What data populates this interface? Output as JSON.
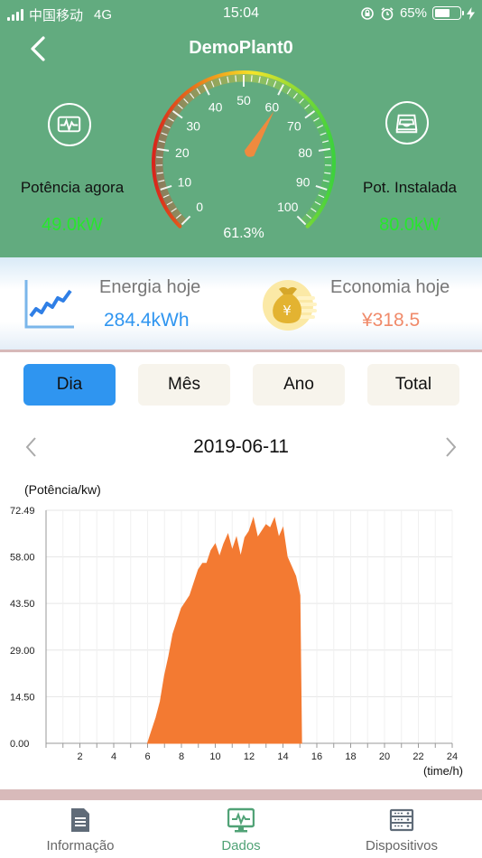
{
  "status_bar": {
    "carrier": "中国移动",
    "network": "4G",
    "time": "15:04",
    "battery_percent": "65%",
    "battery_level": 0.65
  },
  "header": {
    "title": "DemoPlant0",
    "back_icon": "chevron-left-icon"
  },
  "left_panel": {
    "icon": "pulse-icon",
    "label": "Potência agora",
    "value": "49.0kW"
  },
  "right_panel": {
    "icon": "inbox-tray-icon",
    "label": "Pot. Instalada",
    "value": "80.0kW"
  },
  "gauge": {
    "ticks": [
      "0",
      "10",
      "20",
      "30",
      "40",
      "50",
      "60",
      "70",
      "80",
      "90",
      "100"
    ],
    "percent": 61.3,
    "percent_label": "61.3%",
    "needle_color": "#ef8a3e"
  },
  "summary": {
    "energy": {
      "icon": "line-chart-icon",
      "label": "Energia hoje",
      "value": "284.4kWh",
      "color": "#2f95f0"
    },
    "savings": {
      "icon": "money-bag-icon",
      "label": "Economia hoje",
      "value": "¥318.5",
      "color": "#f08a6a"
    }
  },
  "tabs": [
    {
      "label": "Dia",
      "active": true
    },
    {
      "label": "Mês",
      "active": false
    },
    {
      "label": "Ano",
      "active": false
    },
    {
      "label": "Total",
      "active": false
    }
  ],
  "date_nav": {
    "date": "2019-06-11"
  },
  "chart_data": {
    "type": "area",
    "ylabel": "(Potência/kw)",
    "xlabel": "(time/h)",
    "yticks": [
      "72.49",
      "58.00",
      "43.50",
      "29.00",
      "14.50",
      "0.00"
    ],
    "ylim": [
      0,
      72.49
    ],
    "xlim": [
      0,
      24
    ],
    "xticks": [
      "2",
      "4",
      "6",
      "8",
      "10",
      "12",
      "14",
      "16",
      "18",
      "20",
      "22",
      "24"
    ],
    "grid": true,
    "color": "#f37a32",
    "series": [
      {
        "x": [
          6.0,
          6.25,
          6.5,
          6.75,
          7.0,
          7.25,
          7.5,
          7.75,
          8.0,
          8.25,
          8.5,
          8.75,
          9.0,
          9.25,
          9.5,
          9.75,
          10.0,
          10.25,
          10.5,
          10.75,
          11.0,
          11.25,
          11.5,
          11.75,
          12.0,
          12.25,
          12.5,
          12.75,
          13.0,
          13.25,
          13.5,
          13.75,
          14.0,
          14.25,
          14.5,
          14.75,
          15.0,
          15.1
        ],
        "y": [
          0,
          4,
          8,
          13,
          21,
          27,
          34,
          38,
          42,
          44,
          46,
          50,
          54,
          56,
          56,
          60,
          62,
          58,
          62,
          65,
          60,
          64,
          58,
          64,
          66,
          70,
          64,
          66,
          68,
          67,
          70,
          64,
          67,
          58,
          55,
          52,
          46,
          0
        ]
      }
    ]
  },
  "bottom_nav": [
    {
      "label": "Informação",
      "icon": "document-icon",
      "active": false
    },
    {
      "label": "Dados",
      "icon": "monitor-chart-icon",
      "active": true
    },
    {
      "label": "Dispositivos",
      "icon": "server-rack-icon",
      "active": false
    }
  ]
}
